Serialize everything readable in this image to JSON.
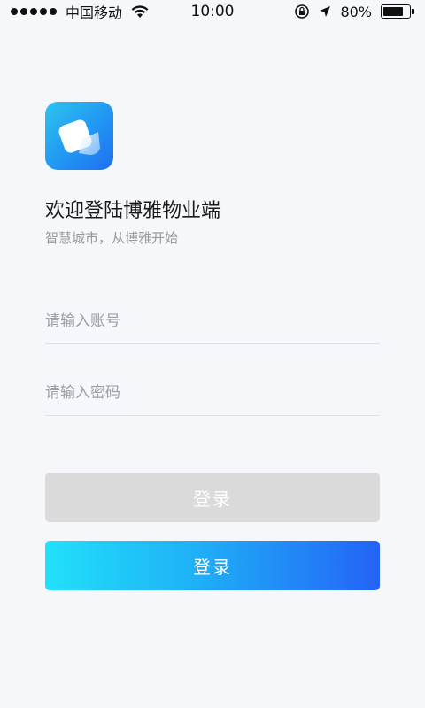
{
  "status_bar": {
    "carrier": "中国移动",
    "time": "10:00",
    "battery": "80%",
    "battery_level": 0.8,
    "icons": [
      "signal-dots-icon",
      "wifi-icon",
      "lock-rotation-icon",
      "location-arrow-icon",
      "battery-icon"
    ]
  },
  "app": {
    "logo_icon": "app-logo-icon",
    "title": "欢迎登陆博雅物业端",
    "subtitle": "智慧城市，从博雅开始"
  },
  "form": {
    "account": {
      "value": "",
      "placeholder": "请输入账号"
    },
    "password": {
      "value": "",
      "placeholder": "请输入密码"
    }
  },
  "buttons": {
    "login_disabled": "登录",
    "login": "登录"
  },
  "colors": {
    "background": "#f5f7fb",
    "disabled_button": "#dadada",
    "gradient_start": "#21e1fb",
    "gradient_end": "#2463f5"
  }
}
